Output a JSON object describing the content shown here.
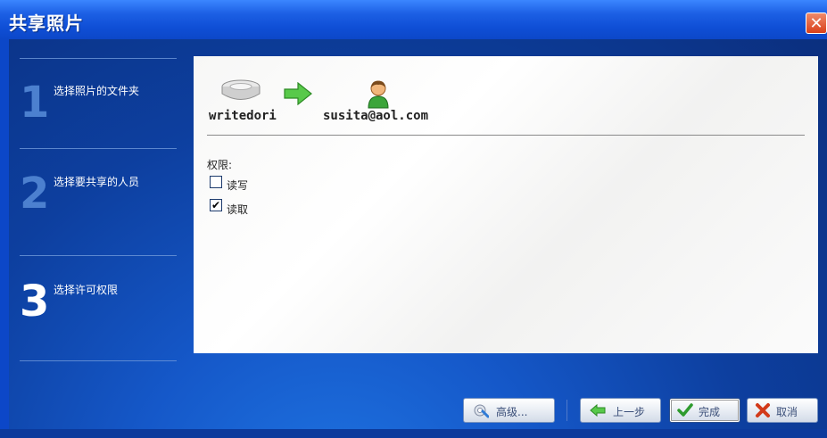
{
  "window": {
    "title": "共享照片",
    "close_glyph": "✕"
  },
  "steps": [
    {
      "number": "1",
      "label": "选择照片的文件夹"
    },
    {
      "number": "2",
      "label": "选择要共享的人员"
    },
    {
      "number": "3",
      "label": "选择许可权限"
    }
  ],
  "share": {
    "source": "writedori",
    "target": "susita@aol.com",
    "icons": [
      "hard-drive-icon",
      "green-arrow-icon",
      "user-icon"
    ]
  },
  "permissions": {
    "label": "权限:",
    "options": [
      {
        "label": "读写",
        "checked": false,
        "mark": ""
      },
      {
        "label": "读取",
        "checked": true,
        "mark": "✔"
      }
    ]
  },
  "buttons": {
    "advanced": "高级...",
    "back": "上一步",
    "finish": "完成",
    "cancel": "取消"
  },
  "colors": {
    "accent": "#0c47c8",
    "arrow": "#49c43a",
    "cancel_x": "#d23a1a",
    "finish_check": "#2e9b2e"
  }
}
